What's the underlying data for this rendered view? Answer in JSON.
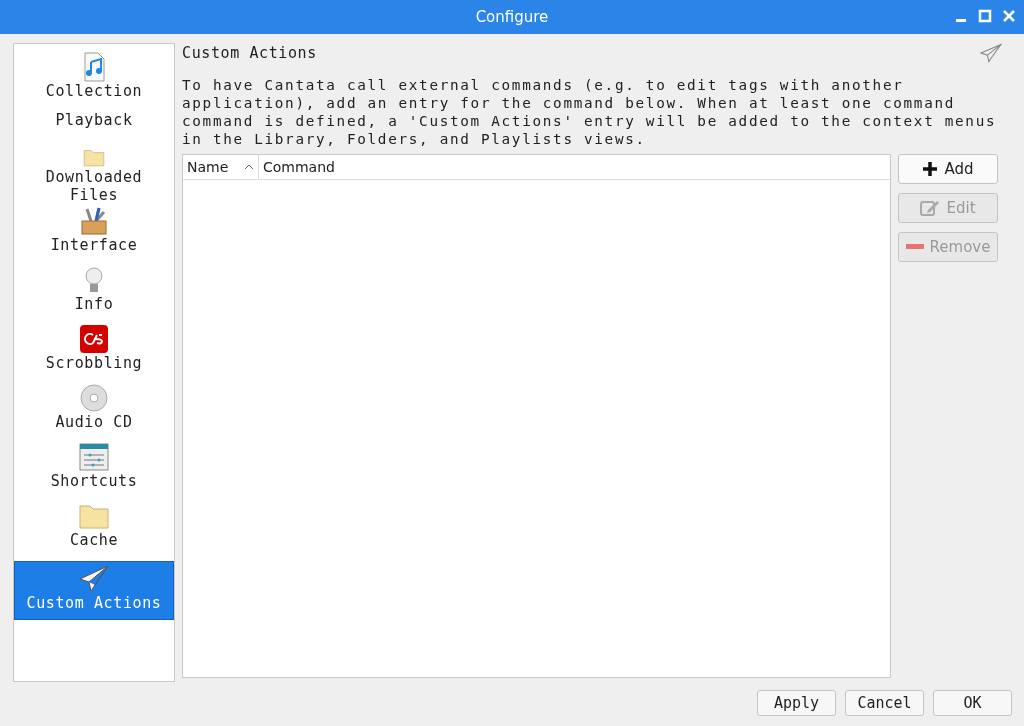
{
  "window": {
    "title": "Configure"
  },
  "sidebar": {
    "items": [
      {
        "label": "Collection",
        "kind": "music-file",
        "selected": false
      },
      {
        "label": "Playback",
        "kind": "blank",
        "selected": false
      },
      {
        "label": "Downloaded Files",
        "kind": "folder",
        "selected": false
      },
      {
        "label": "Interface",
        "kind": "toolbox",
        "selected": false
      },
      {
        "label": "Info",
        "kind": "bulb",
        "selected": false
      },
      {
        "label": "Scrobbling",
        "kind": "scrobble",
        "selected": false
      },
      {
        "label": "Audio CD",
        "kind": "disc",
        "selected": false
      },
      {
        "label": "Shortcuts",
        "kind": "sliders",
        "selected": false
      },
      {
        "label": "Cache",
        "kind": "folder",
        "selected": false
      },
      {
        "label": "Custom Actions",
        "kind": "plane",
        "selected": true
      }
    ]
  },
  "page": {
    "title": "Custom Actions",
    "description": "To have Cantata call external commands (e.g. to edit tags with another application), add an entry for the command below. When at least one command command is defined, a 'Custom Actions' entry will be added to the context menus in the Library, Folders, and Playlists views.",
    "table": {
      "columns": [
        {
          "label": "Name",
          "kind": "sorted"
        },
        {
          "label": "Command",
          "kind": "plain"
        }
      ]
    },
    "buttons": [
      {
        "label": "Add",
        "kind": "plus",
        "disabled": false
      },
      {
        "label": "Edit",
        "kind": "edit",
        "disabled": true
      },
      {
        "label": "Remove",
        "kind": "minus",
        "disabled": true
      }
    ]
  },
  "footer_buttons": [
    "Apply",
    "Cancel",
    "OK"
  ]
}
